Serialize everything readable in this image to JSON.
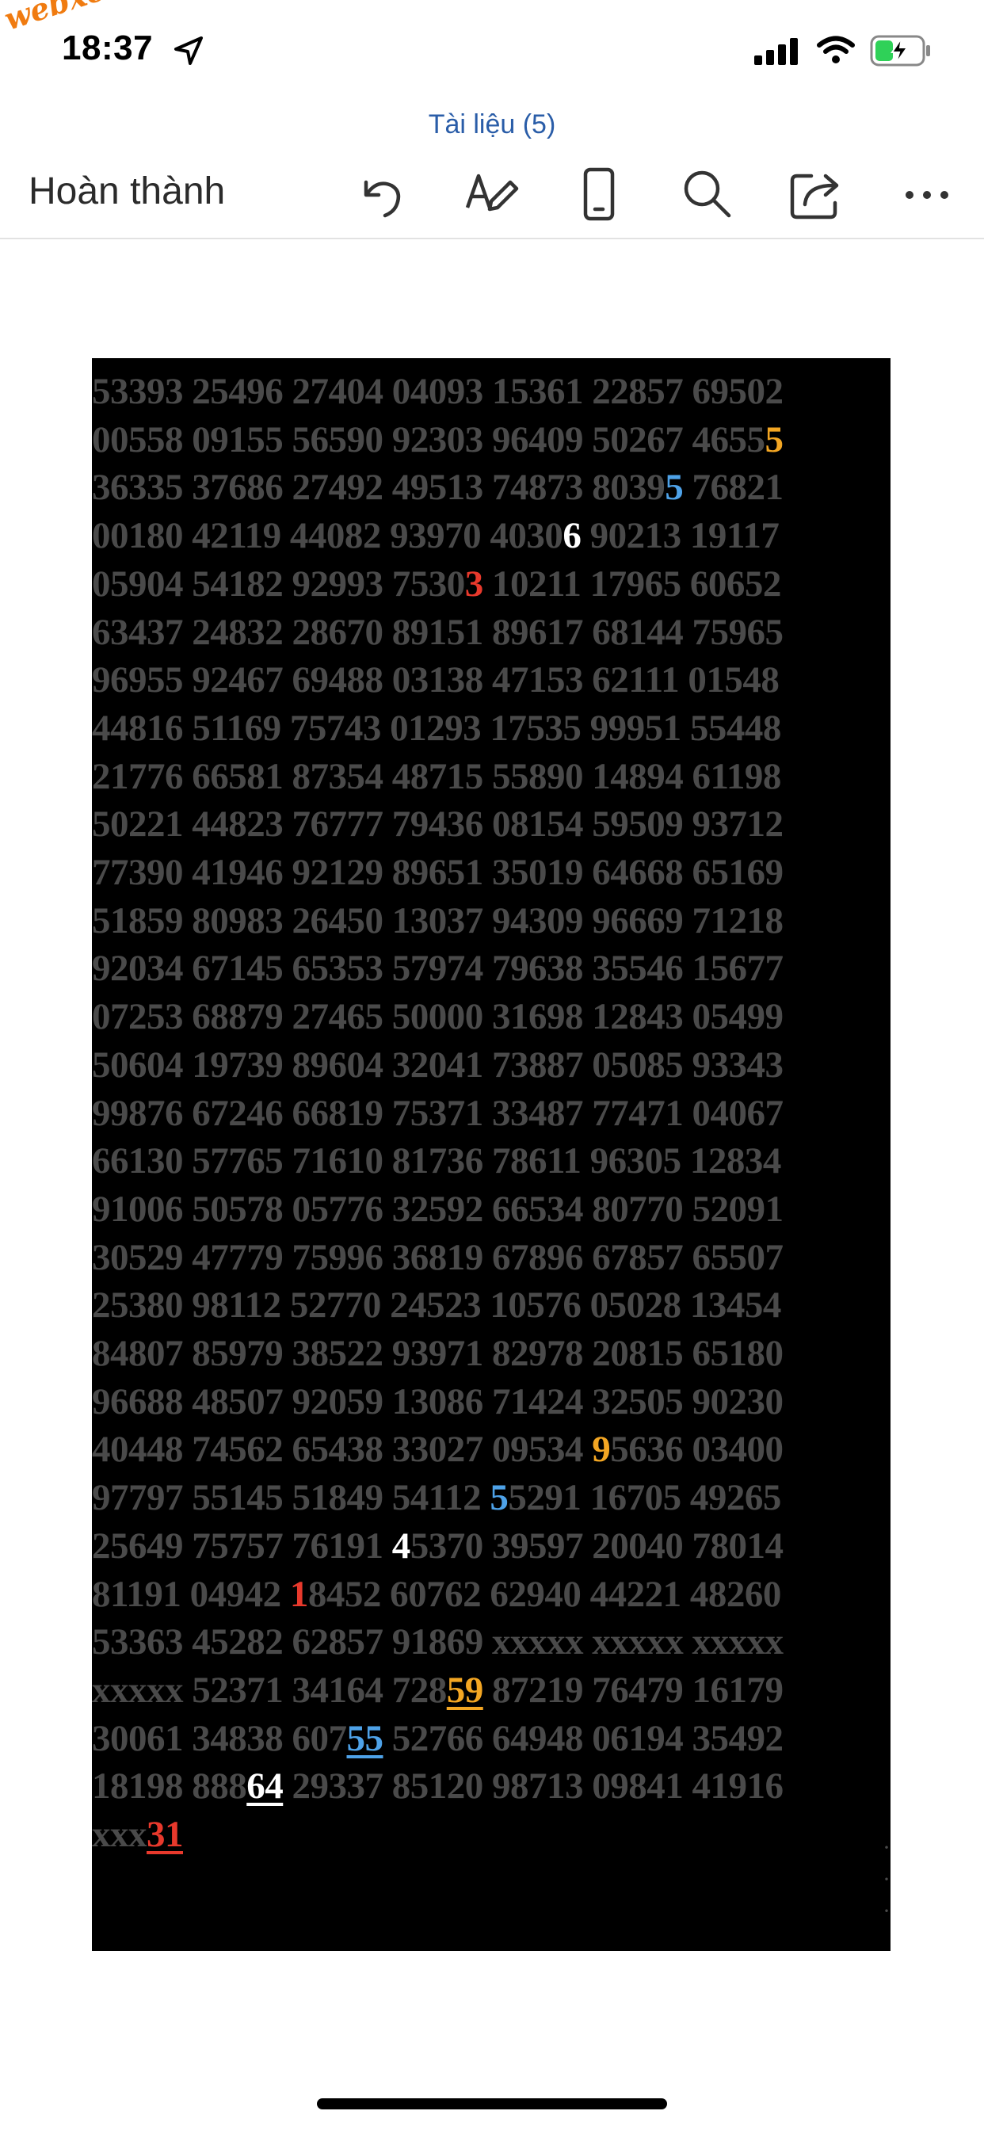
{
  "status": {
    "time": "18:37",
    "watermark": "webxoso.net"
  },
  "header": {
    "doc_title": "Tài liệu (5)",
    "done_label": "Hoàn thành"
  },
  "toolbar_icons": [
    "undo-icon",
    "draw-pen-icon",
    "mobile-view-icon",
    "search-icon",
    "share-icon",
    "more-icon"
  ],
  "colors": {
    "orange": "#f3a623",
    "blue": "#4ea2e8",
    "white": "#ffffff",
    "red": "#e8392c",
    "dim": "#4a4a4a"
  },
  "rows": [
    [
      {
        "t": "53393 25496 27404 04093 15361 22857 69502"
      }
    ],
    [
      {
        "t": "00558 09155 56590 92303 96409 50267 4655"
      },
      {
        "t": "5",
        "c": "orange"
      }
    ],
    [
      {
        "t": "36335 37686 27492 49513 74873 8039"
      },
      {
        "t": "5",
        "c": "blue"
      },
      {
        "t": " 76821"
      }
    ],
    [
      {
        "t": "00180 42119 44082 93970 4030"
      },
      {
        "t": "6",
        "c": "white"
      },
      {
        "t": " 90213 19117"
      }
    ],
    [
      {
        "t": "05904 54182 92993 7530"
      },
      {
        "t": "3",
        "c": "red"
      },
      {
        "t": " 10211 17965 60652"
      }
    ],
    [
      {
        "t": "63437 24832 28670 89151 89617 68144 75965"
      }
    ],
    [
      {
        "t": "96955 92467 69488 03138 47153 62111 01548"
      }
    ],
    [
      {
        "t": "44816 51169 75743 01293 17535 99951 55448"
      }
    ],
    [
      {
        "t": "21776 66581 87354 48715 55890 14894 61198"
      }
    ],
    [
      {
        "t": "50221 44823 76777 79436 08154 59509 93712"
      }
    ],
    [
      {
        "t": "77390 41946 92129 89651 35019 64668 65169"
      }
    ],
    [
      {
        "t": "51859 80983 26450 13037 94309 96669 71218"
      }
    ],
    [
      {
        "t": "92034 67145 65353 57974 79638 35546 15677"
      }
    ],
    [
      {
        "t": "07253 68879 27465 50000 31698 12843 05499"
      }
    ],
    [
      {
        "t": "50604 19739 89604 32041 73887 05085 93343"
      }
    ],
    [
      {
        "t": "99876 67246 66819 75371 33487 77471 04067"
      }
    ],
    [
      {
        "t": "66130 57765 71610 81736 78611 96305 12834"
      }
    ],
    [
      {
        "t": "91006 50578 05776 32592 66534 80770 52091"
      }
    ],
    [
      {
        "t": "30529 47779 75996 36819 67896 67857 65507"
      }
    ],
    [
      {
        "t": "25380 98112 52770 24523 10576 05028 13454"
      }
    ],
    [
      {
        "t": "84807 85979 38522 93971 82978 20815 65180"
      }
    ],
    [
      {
        "t": "96688 48507 92059 13086 71424 32505 90230"
      }
    ],
    [
      {
        "t": "40448 74562 65438 33027 09534 "
      },
      {
        "t": "9",
        "c": "orange"
      },
      {
        "t": "5636 03400"
      }
    ],
    [
      {
        "t": "97797 55145 51849 54112 "
      },
      {
        "t": "5",
        "c": "blue"
      },
      {
        "t": "5291 16705 49265"
      }
    ],
    [
      {
        "t": "25649 75757 76191 "
      },
      {
        "t": "4",
        "c": "white"
      },
      {
        "t": "5370 39597 20040 78014"
      }
    ],
    [
      {
        "t": "81191 04942 "
      },
      {
        "t": "1",
        "c": "red"
      },
      {
        "t": "8452 60762 62940 44221 48260"
      }
    ],
    [
      {
        "t": "53363 45282 62857 91869 xxxxx xxxxx xxxxx"
      }
    ],
    [
      {
        "t": "xxxxx 52371 34164 728"
      },
      {
        "t": "59",
        "c": "orange",
        "u": true
      },
      {
        "t": " 87219 76479 16179"
      }
    ],
    [
      {
        "t": "30061 34838 607"
      },
      {
        "t": "55",
        "c": "blue",
        "u": true
      },
      {
        "t": " 52766 64948 06194 35492"
      }
    ],
    [
      {
        "t": "18198 888"
      },
      {
        "t": "64",
        "c": "white",
        "u": true
      },
      {
        "t": " 29337 85120 98713 09841 41916"
      }
    ],
    [
      {
        "t": "xxx"
      },
      {
        "t": "31",
        "c": "red",
        "u": true
      }
    ]
  ]
}
